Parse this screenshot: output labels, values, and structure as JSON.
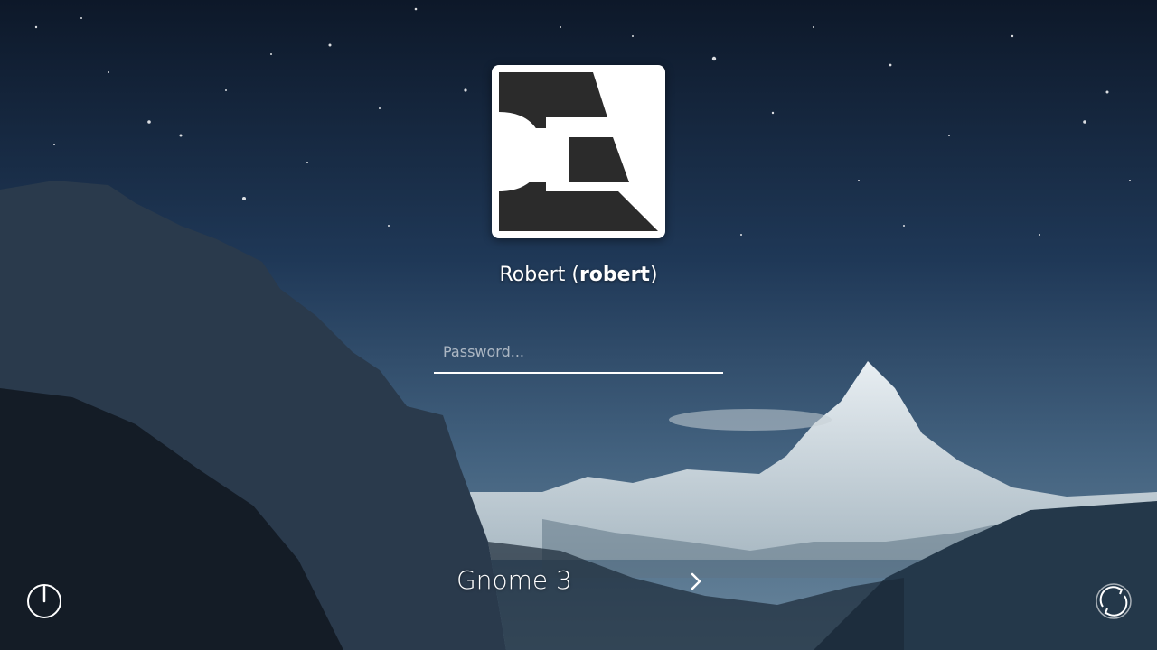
{
  "background": {
    "description_icon": "mountain-night-sky"
  },
  "user": {
    "display_name": "Robert",
    "login": "robert",
    "avatar_icon": "user-avatar-logo"
  },
  "password": {
    "placeholder": "Password...",
    "value": ""
  },
  "session": {
    "name": "Gnome 3",
    "next_icon": "chevron-right-icon"
  },
  "controls": {
    "power_icon": "power-icon",
    "switch_icon": "refresh-icon"
  },
  "colors": {
    "text": "#ffffff",
    "avatar_bg": "#ffffff",
    "avatar_logo": "#2b2b2b"
  }
}
